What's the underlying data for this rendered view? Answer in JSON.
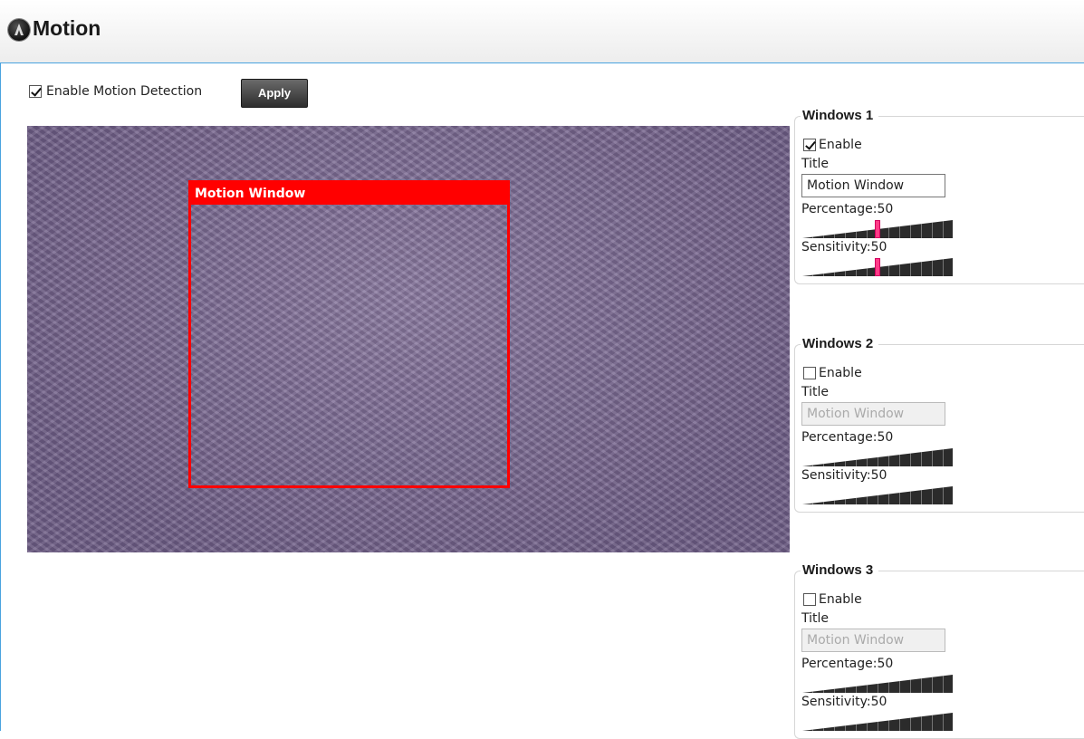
{
  "header": {
    "title": "Motion",
    "icon": "motion-icon"
  },
  "top": {
    "enable_label": "Enable Motion Detection",
    "enable_checked": true,
    "apply_label": "Apply"
  },
  "preview": {
    "window_label": "Motion Window",
    "window_color": "#ff0000"
  },
  "windows": [
    {
      "legend": "Windows 1",
      "enable_label": "Enable",
      "enabled": true,
      "title_label": "Title",
      "title_value": "Motion Window",
      "percentage_label": "Percentage:50",
      "percentage": 50,
      "sensitivity_label": "Sensitivity:50",
      "sensitivity": 50
    },
    {
      "legend": "Windows 2",
      "enable_label": "Enable",
      "enabled": false,
      "title_label": "Title",
      "title_value": "Motion Window",
      "percentage_label": "Percentage:50",
      "percentage": 50,
      "sensitivity_label": "Sensitivity:50",
      "sensitivity": 50
    },
    {
      "legend": "Windows 3",
      "enable_label": "Enable",
      "enabled": false,
      "title_label": "Title",
      "title_value": "Motion Window",
      "percentage_label": "Percentage:50",
      "percentage": 50,
      "sensitivity_label": "Sensitivity:50",
      "sensitivity": 50
    }
  ],
  "colors": {
    "accent_border": "#4aa3df",
    "slider_thumb": "#ff3b87",
    "button_bg": "#3a3a3a"
  }
}
